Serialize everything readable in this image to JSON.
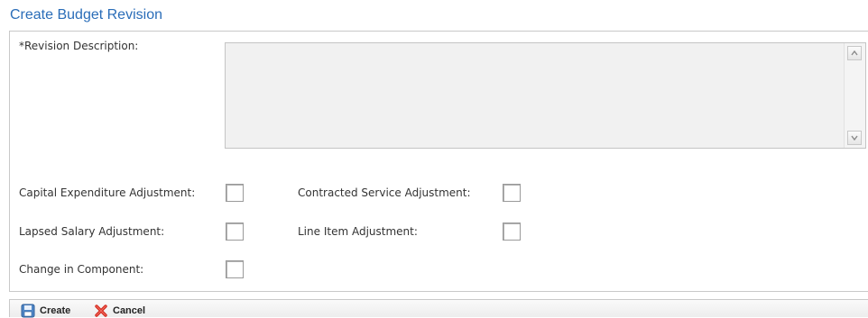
{
  "page": {
    "title": "Create Budget Revision"
  },
  "form": {
    "description_label": "*Revision Description:",
    "description_value": "",
    "checkboxes": {
      "capital_expenditure": {
        "label": "Capital Expenditure Adjustment:",
        "checked": false
      },
      "contracted_service": {
        "label": "Contracted Service Adjustment:",
        "checked": false
      },
      "lapsed_salary": {
        "label": "Lapsed Salary Adjustment:",
        "checked": false
      },
      "line_item": {
        "label": "Line Item Adjustment:",
        "checked": false
      },
      "change_in_component": {
        "label": "Change in Component:",
        "checked": false
      }
    }
  },
  "toolbar": {
    "create_label": "Create",
    "cancel_label": "Cancel",
    "create_icon": "save-disk-icon",
    "cancel_icon": "red-x-icon"
  },
  "colors": {
    "title": "#2a6db8",
    "cancel_icon": "#d42a1e"
  }
}
